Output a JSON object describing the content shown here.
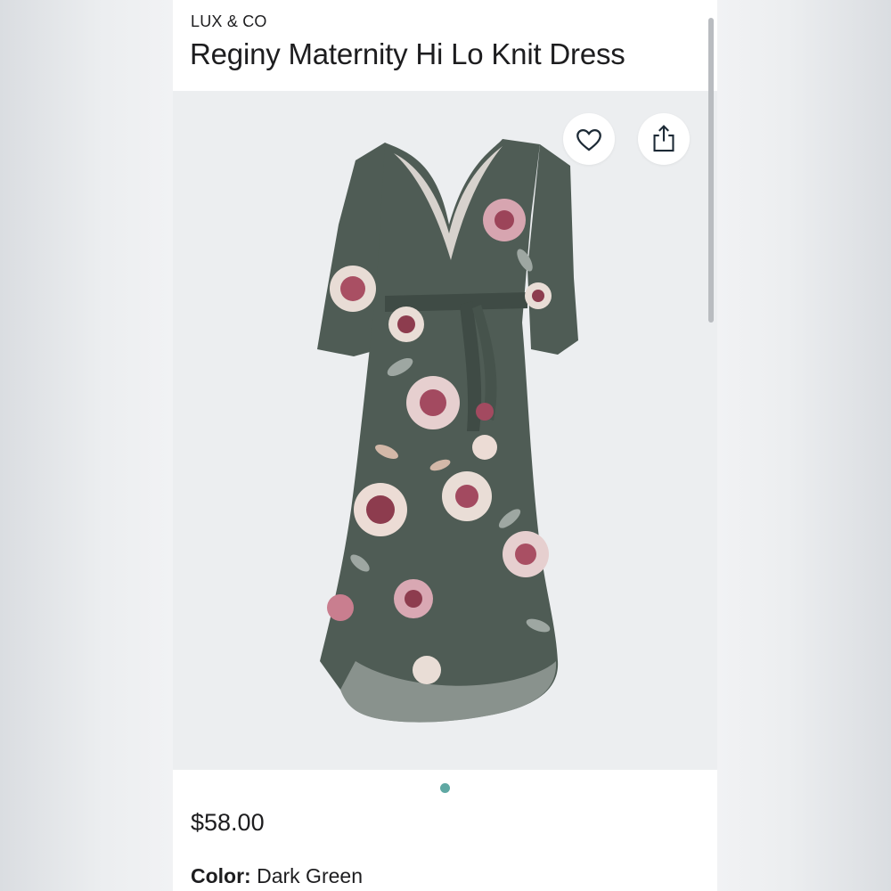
{
  "product": {
    "brand": "LUX & CO",
    "title": "Reginy Maternity Hi Lo Knit Dress",
    "price": "$58.00",
    "color_label": "Color:",
    "color_value": "Dark Green",
    "image_alt": "Reginy Maternity Hi Lo Knit Dress in Dark Green floral print"
  },
  "actions": {
    "favorite_icon": "heart-icon",
    "share_icon": "share-icon"
  },
  "carousel": {
    "total": 1,
    "active": 1,
    "active_color": "#5fa8a3"
  },
  "colors": {
    "dress_base": "#4f5c55",
    "accent_dot": "#5fa8a3",
    "text": "#1d1d1f",
    "image_bg": "#eceef0"
  }
}
